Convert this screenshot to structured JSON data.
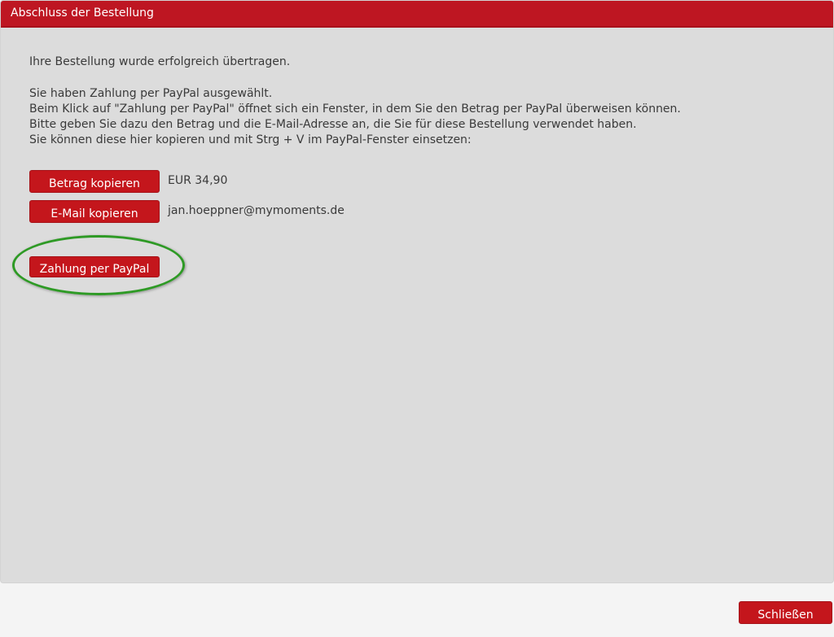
{
  "dialog": {
    "title": "Abschluss der Bestellung"
  },
  "content": {
    "success_message": "Ihre Bestellung wurde erfolgreich übertragen.",
    "instructions": [
      "Sie haben Zahlung per PayPal ausgewählt.",
      "Beim Klick auf \"Zahlung per PayPal\" öffnet sich ein Fenster, in dem Sie den Betrag per PayPal überweisen können.",
      "Bitte geben Sie dazu den Betrag und die E-Mail-Adresse an, die Sie für diese Bestellung verwendet haben.",
      "Sie können diese hier kopieren und mit Strg + V im PayPal-Fenster einsetzen:"
    ]
  },
  "copy_amount": {
    "button_label": "Betrag kopieren",
    "value": "EUR 34,90"
  },
  "copy_email": {
    "button_label": "E-Mail kopieren",
    "value": "jan.hoeppner@mymoments.de"
  },
  "paypal": {
    "button_label": "Zahlung per PayPal"
  },
  "footer": {
    "close_label": "Schließen"
  },
  "colors": {
    "accent": "#c4161c",
    "dialog_background": "#dcdcdc",
    "highlight": "#2e9a25"
  }
}
